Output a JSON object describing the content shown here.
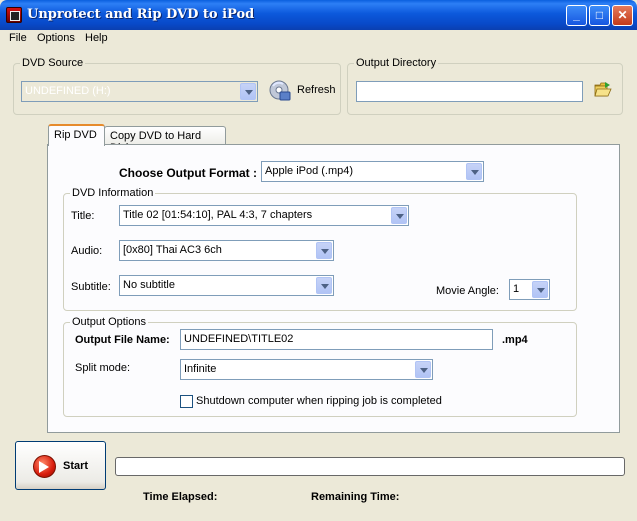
{
  "window": {
    "title": "Unprotect and Rip DVD to iPod",
    "minimize_glyph": "_",
    "maximize_glyph": "□",
    "close_glyph": "✕"
  },
  "menu": [
    "File",
    "Options",
    "Help"
  ],
  "dvd_source": {
    "legend": "DVD Source",
    "selected": "UNDEFINED (H:)",
    "refresh_label": "Refresh",
    "refresh_icon": "disc-refresh-icon"
  },
  "output_directory": {
    "legend": "Output Directory",
    "value": "",
    "browse_icon": "open-folder-icon"
  },
  "tabs": [
    {
      "label": "Rip DVD",
      "active": true
    },
    {
      "label": "Copy DVD to Hard Disk",
      "active": false
    }
  ],
  "rip": {
    "format_label": "Choose Output Format :",
    "format_value": "Apple iPod (.mp4)",
    "dvd_info": {
      "legend": "DVD Information",
      "title_label": "Title:",
      "title_value": "Title 02 [01:54:10], PAL 4:3, 7 chapters",
      "audio_label": "Audio:",
      "audio_value": "[0x80] Thai AC3 6ch",
      "subtitle_label": "Subtitle:",
      "subtitle_value": "No subtitle",
      "angle_label": "Movie Angle:",
      "angle_value": "1"
    },
    "output_options": {
      "legend": "Output Options",
      "filename_label": "Output File Name:",
      "filename_value": "UNDEFINED\\TITLE02",
      "extension": ".mp4",
      "split_label": "Split mode:",
      "split_value": "Infinite",
      "shutdown_label": "Shutdown computer when ripping job is completed",
      "shutdown_checked": false
    }
  },
  "controls": {
    "start_label": "Start",
    "start_icon": "start-arrow-icon",
    "progress_value": 0,
    "time_elapsed_label": "Time Elapsed:",
    "remaining_time_label": "Remaining Time:"
  },
  "colors": {
    "titlebar": "#0a5fde",
    "window_bg": "#ece9d8",
    "tab_accent": "#e68b2c"
  }
}
